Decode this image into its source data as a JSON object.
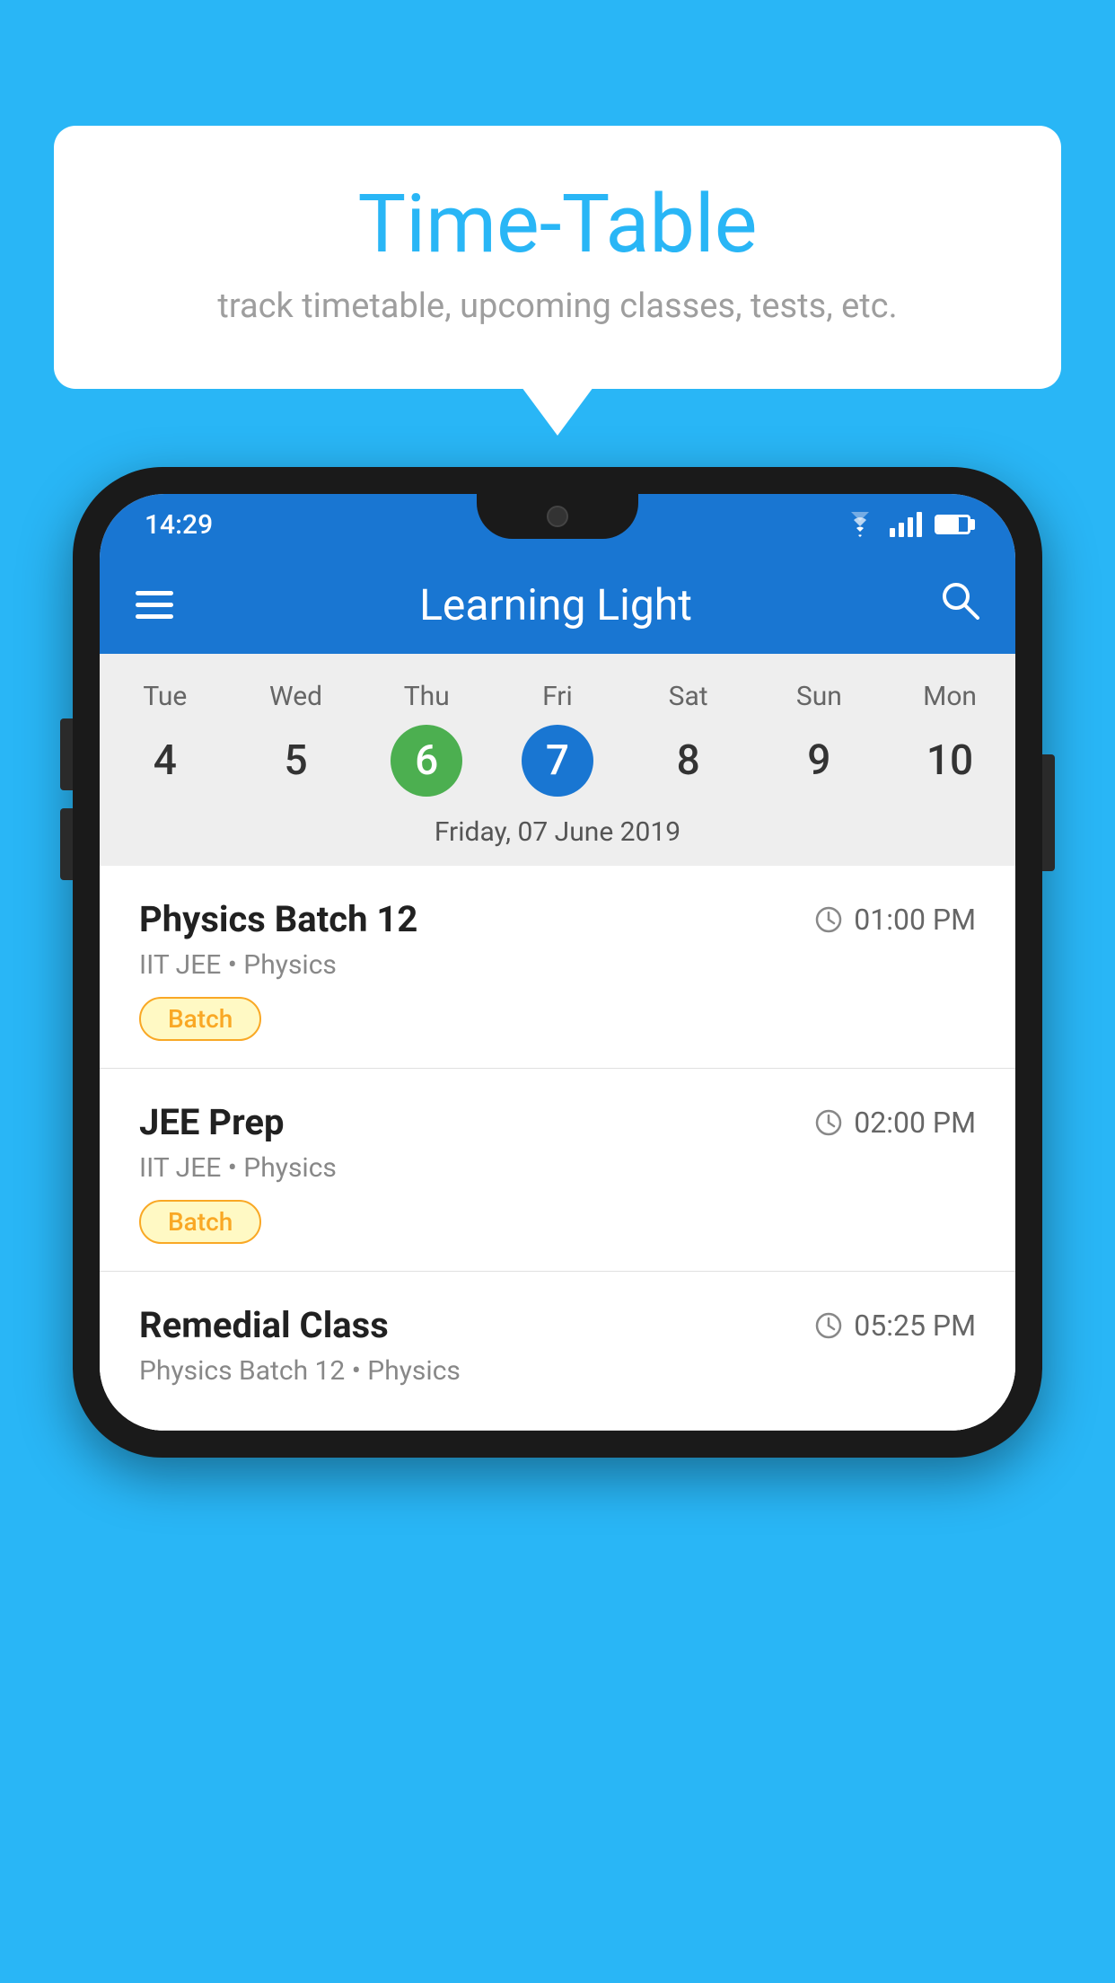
{
  "background": {
    "color": "#29B6F6"
  },
  "speech_bubble": {
    "title": "Time-Table",
    "subtitle": "track timetable, upcoming classes, tests, etc."
  },
  "phone": {
    "status_bar": {
      "time": "14:29"
    },
    "app_bar": {
      "title": "Learning Light"
    },
    "calendar": {
      "days": [
        {
          "name": "Tue",
          "num": "4",
          "state": "normal"
        },
        {
          "name": "Wed",
          "num": "5",
          "state": "normal"
        },
        {
          "name": "Thu",
          "num": "6",
          "state": "today"
        },
        {
          "name": "Fri",
          "num": "7",
          "state": "selected"
        },
        {
          "name": "Sat",
          "num": "8",
          "state": "normal"
        },
        {
          "name": "Sun",
          "num": "9",
          "state": "normal"
        },
        {
          "name": "Mon",
          "num": "10",
          "state": "normal"
        }
      ],
      "selected_date_label": "Friday, 07 June 2019"
    },
    "schedule": [
      {
        "title": "Physics Batch 12",
        "time": "01:00 PM",
        "subtitle": "IIT JEE • Physics",
        "badge": "Batch"
      },
      {
        "title": "JEE Prep",
        "time": "02:00 PM",
        "subtitle": "IIT JEE • Physics",
        "badge": "Batch"
      },
      {
        "title": "Remedial Class",
        "time": "05:25 PM",
        "subtitle": "Physics Batch 12 • Physics",
        "badge": null
      }
    ]
  }
}
